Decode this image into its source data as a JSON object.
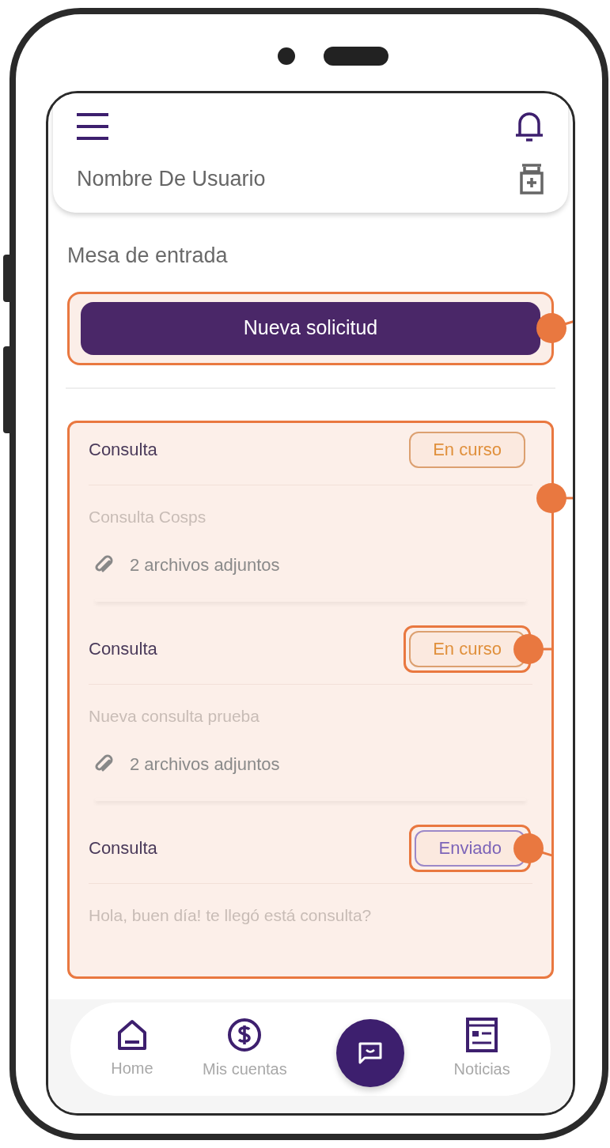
{
  "header": {
    "user_name": "Nombre De Usuario"
  },
  "section_title": "Mesa de entrada",
  "new_request_button": {
    "label": "Nueva solicitud",
    "annotated": true
  },
  "requests": {
    "annotated": true,
    "items": [
      {
        "title": "Consulta",
        "status": {
          "label": "En curso",
          "kind": "in_progress",
          "annotated": false
        },
        "description": "Consulta Cosps",
        "attachments": "2 archivos adjuntos"
      },
      {
        "title": "Consulta",
        "status": {
          "label": "En curso",
          "kind": "in_progress",
          "annotated": true
        },
        "description": "Nueva consulta prueba",
        "attachments": "2 archivos adjuntos"
      },
      {
        "title": "Consulta",
        "status": {
          "label": "Enviado",
          "kind": "sent",
          "annotated": true
        },
        "description": "Hola, buen día! te llegó está consulta?"
      }
    ]
  },
  "bottom_nav": [
    {
      "kind": "home",
      "label": "Home"
    },
    {
      "kind": "accounts",
      "label": "Mis cuentas"
    },
    {
      "kind": "chat"
    },
    {
      "kind": "news",
      "label": "Noticias"
    }
  ]
}
